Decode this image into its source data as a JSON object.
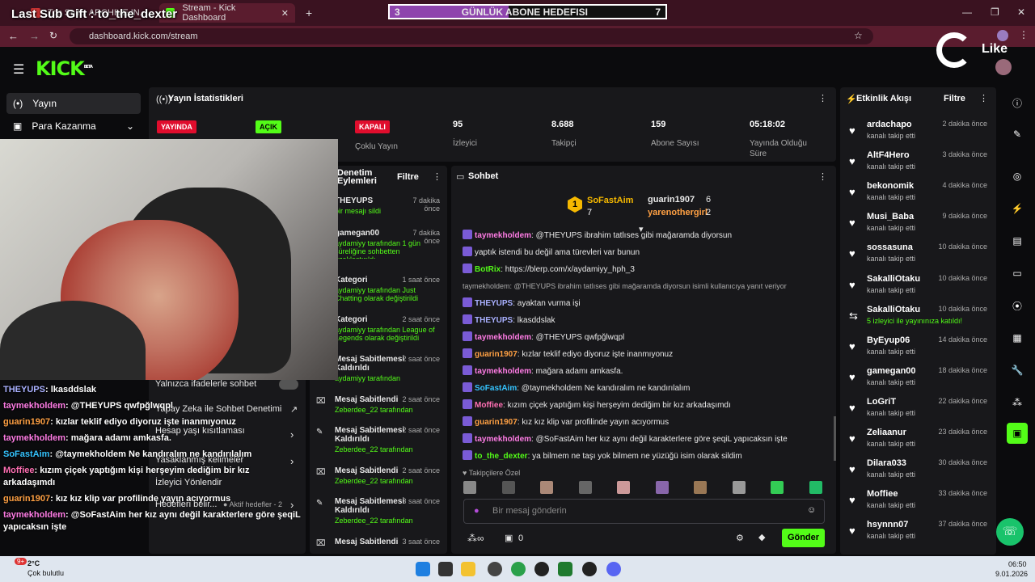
{
  "overlay": {
    "sub_gift": "Last Sub Gift : to_the_dexter",
    "goal_current": "3",
    "goal_title": "GÜNLÜK ABONE HEDEFISI",
    "goal_target": "7",
    "goal_fraction": 0.43,
    "like_label": "Like"
  },
  "browser": {
    "tab1": "Top Sell... ARCHIVE IN...",
    "tab2": "Stream - Kick Dashboard",
    "url": "dashboard.kick.com/stream"
  },
  "kick": {
    "logo": "KICK",
    "beta": "BETA"
  },
  "nav": {
    "yayin": "Yayın",
    "para": "Para Kazanma"
  },
  "stats": {
    "title": "Yayın İstatistikleri",
    "yayinda": "YAYINDA",
    "acik": "AÇIK",
    "kapali": "KAPALI",
    "coklu": "Çoklu Yayın",
    "izleyici_val": "95",
    "izleyici_lbl": "İzleyici",
    "takipci_val": "8.688",
    "takipci_lbl": "Takipçi",
    "abone_val": "159",
    "abone_lbl": "Abone Sayısı",
    "sure_val": "05:18:02",
    "sure_lbl1": "Yayında Olduğu",
    "sure_lbl2": "Süre"
  },
  "mod": {
    "title1": "Denetim",
    "title2": "Eylemleri",
    "filter": "Filtre",
    "items": [
      {
        "title": "THEYUPS",
        "time": "7 dakika önce",
        "desc": "bir mesajı sildi"
      },
      {
        "title": "gamegan00",
        "time": "7 dakika önce",
        "desc": "aydamiyy tarafından 1 gün süreliğine sohbetten uzaklaştırıldı"
      },
      {
        "title": "Kategori",
        "time": "1 saat önce",
        "desc": "aydamiyy tarafından Just Chatting olarak değiştirildi"
      },
      {
        "title": "Kategori",
        "time": "2 saat önce",
        "desc": "aydamiyy tarafından League of Legends olarak değiştirildi"
      },
      {
        "title": "Mesaj Sabitlemesi Kaldırıldı",
        "time": "2 saat önce",
        "desc": "aydamiyy tarafından"
      },
      {
        "title": "Mesaj Sabitlendi",
        "time": "2 saat önce",
        "desc": "Zeberdee_22 tarafından"
      },
      {
        "title": "Mesaj Sabitlemesi Kaldırıldı",
        "time": "2 saat önce",
        "desc": "Zeberdee_22 tarafından"
      },
      {
        "title": "Mesaj Sabitlendi",
        "time": "2 saat önce",
        "desc": "Zeberdee_22 tarafından"
      },
      {
        "title": "Mesaj Sabitlemesi Kaldırıldı",
        "time": "3 saat önce",
        "desc": "Zeberdee_22 tarafından"
      },
      {
        "title": "Mesaj Sabitlendi",
        "time": "3 saat önce",
        "desc": ""
      }
    ]
  },
  "settings": {
    "only_emotes": "Yalnızca ifadelerle sohbet",
    "botrix_mod": "Yapay Zeka ile Sohbet Denetimi",
    "age": "Hesap yaşı kısıtlaması",
    "banned_words": "Yasaklanmış kelimeler",
    "viewer_goals": "İzleyici Yönlendir",
    "goals": "Hedefleri belir...",
    "goals_badge": "Aktif hedefler - 2"
  },
  "chat": {
    "title": "Sohbet",
    "leader1_name": "SoFastAim",
    "leader1_count": "7",
    "leader2_name": "guarin1907",
    "leader2_count": "6",
    "leader3_name": "yarenothergirl",
    "leader3_count": "2",
    "messages": [
      {
        "user": "taymekholdem",
        "color": "#ff7ce5",
        "text": "@THEYUPS ibrahim tatlıses gibi mağaramda diyorsun"
      },
      {
        "user": "",
        "color": "#fff",
        "text": "yaptık istendi bu değil ama türevleri var bunun"
      },
      {
        "user": "BotRix",
        "color": "#53fc18",
        "text": "https://blerp.com/x/aydamiyy_hph_3"
      },
      {
        "user": "",
        "color": "#aaa",
        "text": "taymekholdem: @THEYUPS ibrahim tatlıses gibi mağaramda diyorsun isimli kullanıcıya yanıt veriyor"
      },
      {
        "user": "THEYUPS",
        "color": "#a9b0ff",
        "text": "ayaktan vurma işi"
      },
      {
        "user": "THEYUPS",
        "color": "#a9b0ff",
        "text": "lkasddslak"
      },
      {
        "user": "taymekholdem",
        "color": "#ff7ce5",
        "text": "@THEYUPS qwfpğlwqpl"
      },
      {
        "user": "guarin1907",
        "color": "#ffa043",
        "text": "kızlar teklif ediyo diyoruz işte inanmıyonuz"
      },
      {
        "user": "taymekholdem",
        "color": "#ff7ce5",
        "text": "mağara adamı amkasfa."
      },
      {
        "user": "SoFastAim",
        "color": "#35c4ff",
        "text": "@taymekholdem Ne kandıralım ne kandırılalım"
      },
      {
        "user": "Moffiee",
        "color": "#ff6fb3",
        "text": "kızım çiçek yaptığım kişi herşeyim dediğim bir kız arkadaşımdı"
      },
      {
        "user": "guarin1907",
        "color": "#ffa043",
        "text": "kız kız klip var profilinde yayın acıyormus"
      },
      {
        "user": "taymekholdem",
        "color": "#ff7ce5",
        "text": "@SoFastAim her kız aynı değil karakterlere göre şeqiL yapıcaksın işte"
      },
      {
        "user": "to_the_dexter",
        "color": "#53fc18",
        "text": "ya bilmem ne taşı yok bilmem ne yüzüğü isim olarak sildim"
      }
    ],
    "followers_only": "Takipçilere Özel",
    "input_placeholder": "Bir mesaj gönderin",
    "points": "0",
    "send": "Gönder"
  },
  "overlay_chat": [
    {
      "user": "THEYUPS",
      "color": "#a9b0ff",
      "text": "lkasddslak"
    },
    {
      "user": "taymekholdem",
      "color": "#ff7ce5",
      "text": "@THEYUPS qwfpğlwqpl"
    },
    {
      "user": "guarin1907",
      "color": "#ffa043",
      "text": "kızlar teklif ediyo diyoruz işte inanmıyonuz"
    },
    {
      "user": "taymekholdem",
      "color": "#ff7ce5",
      "text": "mağara adamı amkasfa."
    },
    {
      "user": "SoFastAim",
      "color": "#35c4ff",
      "text": "@taymekholdem Ne kandıralım ne kandırılalım"
    },
    {
      "user": "Moffiee",
      "color": "#ff6fb3",
      "text": "kızım çiçek yaptığım kişi herşeyim dediğim bir kız arkadaşımdı"
    },
    {
      "user": "guarin1907",
      "color": "#ffa043",
      "text": "kız kız klip var profilinde yayın acıyormus"
    },
    {
      "user": "taymekholdem",
      "color": "#ff7ce5",
      "text": "@SoFastAim her kız aynı değil karakterlere göre şeqiL yapıcaksın işte"
    }
  ],
  "activity": {
    "title": "Etkinlik Akışı",
    "filter": "Filtre",
    "items": [
      {
        "name": "ardachapo",
        "sub": "kanalı takip etti",
        "time": "2 dakika önce"
      },
      {
        "name": "AltF4Hero",
        "sub": "kanalı takip etti",
        "time": "3 dakika önce"
      },
      {
        "name": "bekonomik",
        "sub": "kanalı takip etti",
        "time": "4 dakika önce"
      },
      {
        "name": "Musi_Baba",
        "sub": "kanalı takip etti",
        "time": "9 dakika önce"
      },
      {
        "name": "sossasuna",
        "sub": "kanalı takip etti",
        "time": "10 dakika önce"
      },
      {
        "name": "SakalliOtaku",
        "sub": "kanalı takip etti",
        "time": "10 dakika önce"
      },
      {
        "name": "SakalliOtaku",
        "sub": "5 izleyici ile yayınınıza katıldı!",
        "time": "10 dakika önce"
      },
      {
        "name": "ByEyup06",
        "sub": "kanalı takip etti",
        "time": "14 dakika önce"
      },
      {
        "name": "gamegan00",
        "sub": "kanalı takip etti",
        "time": "18 dakika önce"
      },
      {
        "name": "LoGriT",
        "sub": "kanalı takip etti",
        "time": "22 dakika önce"
      },
      {
        "name": "Zeliaanur",
        "sub": "kanalı takip etti",
        "time": "23 dakika önce"
      },
      {
        "name": "Dilara033",
        "sub": "kanalı takip etti",
        "time": "30 dakika önce"
      },
      {
        "name": "Moffiee",
        "sub": "kanalı takip etti",
        "time": "33 dakika önce"
      },
      {
        "name": "hsynnn07",
        "sub": "kanalı takip etti",
        "time": "37 dakika önce"
      }
    ]
  },
  "taskbar": {
    "temp": "2°C",
    "weather": "Çok bulutlu",
    "time": "06:50",
    "date": "9.01.2026",
    "badge": "9+"
  }
}
